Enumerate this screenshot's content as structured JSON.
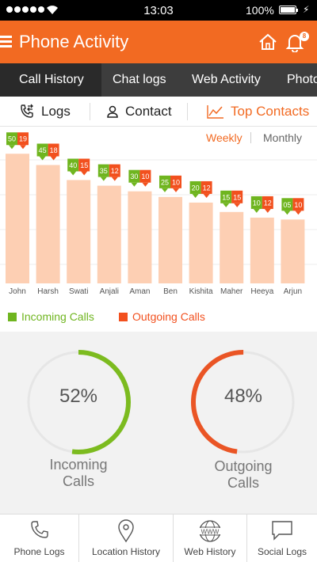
{
  "status_bar": {
    "time": "13:03",
    "battery": "100%"
  },
  "header": {
    "title": "Phone Activity",
    "notification_count": "8"
  },
  "top_tabs": [
    "Call History",
    "Chat logs",
    "Web Activity",
    "Photo"
  ],
  "sub_tabs": {
    "logs": "Logs",
    "contact": "Contact",
    "top_contacts": "Top Contacts"
  },
  "period": {
    "weekly": "Weekly",
    "monthly": "Monthly"
  },
  "colors": {
    "brand": "#f26a22",
    "incoming": "#6fb51f",
    "outgoing": "#f2501e",
    "bar": "#fdcfb3"
  },
  "chart_data": {
    "type": "bar",
    "categories": [
      "John",
      "Harsh",
      "Swati",
      "Anjali",
      "Aman",
      "Ben",
      "Kishita",
      "Maher",
      "Heeya",
      "Arjun"
    ],
    "values": [
      69,
      63,
      55,
      52,
      49,
      46,
      43,
      38,
      35,
      34
    ],
    "series": [
      {
        "name": "Incoming Calls",
        "values": [
          50,
          45,
          40,
          35,
          30,
          25,
          20,
          15,
          10,
          5
        ]
      },
      {
        "name": "Outgoing Calls",
        "values": [
          19,
          18,
          15,
          12,
          10,
          10,
          12,
          15,
          12,
          10
        ]
      }
    ],
    "incoming_labels": [
      "50",
      "45",
      "40",
      "35",
      "30",
      "25",
      "20",
      "15",
      "10",
      "05"
    ],
    "outgoing_labels": [
      "19",
      "18",
      "15",
      "12",
      "10",
      "10",
      "12",
      "15",
      "12",
      "10"
    ],
    "ylim": [
      0,
      75
    ],
    "grid": true,
    "legend": "bottom-left"
  },
  "legend": {
    "incoming": "Incoming Calls",
    "outgoing": "Outgoing Calls"
  },
  "donuts": {
    "incoming": {
      "value": 52,
      "label": "52%",
      "caption_line1": "Incoming",
      "caption_line2": "Calls"
    },
    "outgoing": {
      "value": 48,
      "label": "48%",
      "caption_line1": "Outgoing",
      "caption_line2": "Calls"
    }
  },
  "bottom_nav": [
    {
      "label": "Phone Logs",
      "icon": "phone-icon"
    },
    {
      "label": "Location History",
      "icon": "location-pin-icon"
    },
    {
      "label": "Web History",
      "icon": "globe-www-icon"
    },
    {
      "label": "Social Logs",
      "icon": "chat-bubble-icon"
    }
  ]
}
